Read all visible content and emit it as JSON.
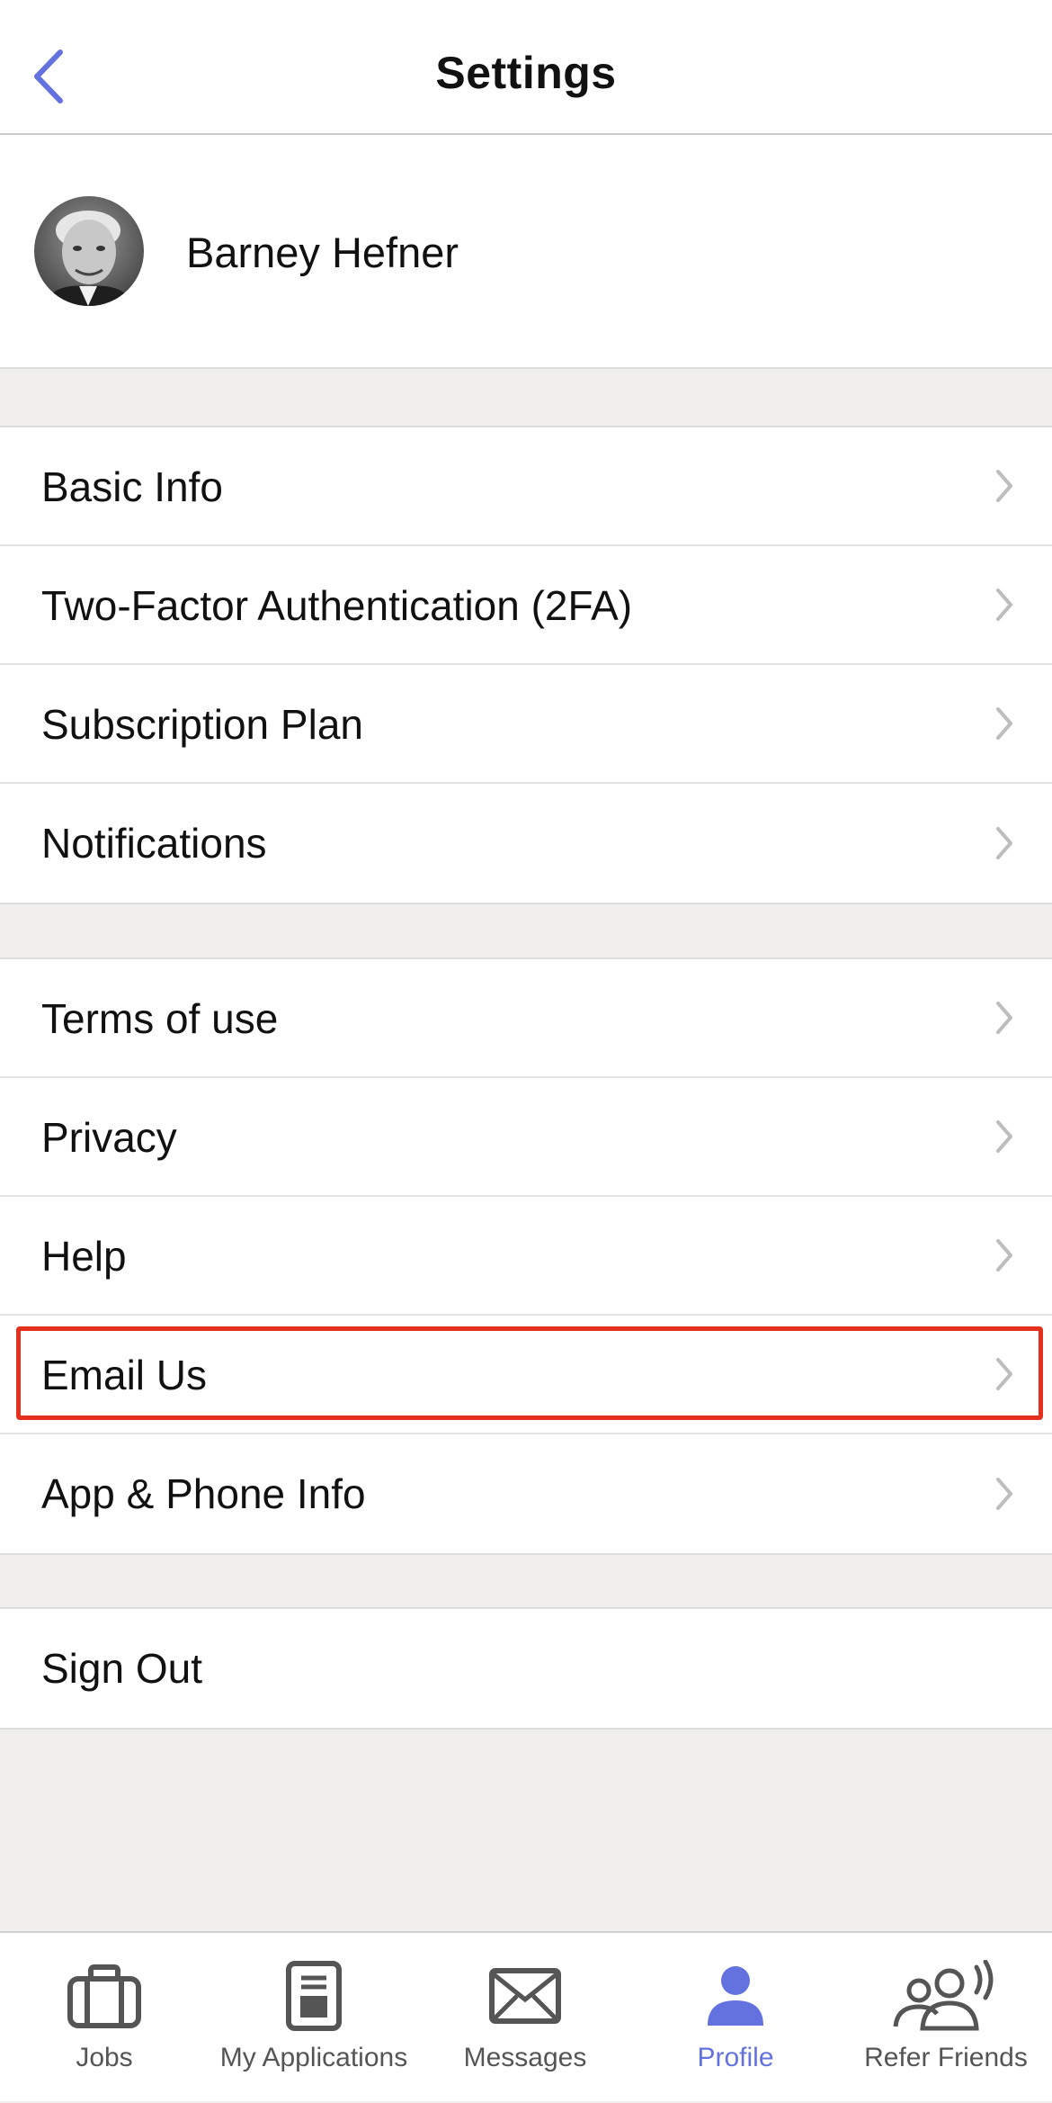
{
  "nav": {
    "title": "Settings",
    "back_icon": "chevron-left-icon",
    "accent_color": "#6472e0"
  },
  "profile": {
    "name": "Barney Hefner"
  },
  "account_group": [
    {
      "label": "Basic Info"
    },
    {
      "label": "Two-Factor Authentication (2FA)"
    },
    {
      "label": "Subscription Plan"
    },
    {
      "label": "Notifications"
    }
  ],
  "info_group": [
    {
      "label": "Terms of use"
    },
    {
      "label": "Privacy"
    },
    {
      "label": "Help"
    },
    {
      "label": "Email Us",
      "highlighted": true
    },
    {
      "label": "App & Phone Info"
    }
  ],
  "signout_group": [
    {
      "label": "Sign Out"
    }
  ],
  "highlight_color": "#e4301c",
  "tabs": [
    {
      "label": "Jobs",
      "icon": "briefcase-icon",
      "active": false
    },
    {
      "label": "My Applications",
      "icon": "applications-icon",
      "active": false
    },
    {
      "label": "Messages",
      "icon": "envelope-icon",
      "active": false
    },
    {
      "label": "Profile",
      "icon": "person-icon",
      "active": true
    },
    {
      "label": "Refer Friends",
      "icon": "refer-friends-icon",
      "active": false
    }
  ]
}
